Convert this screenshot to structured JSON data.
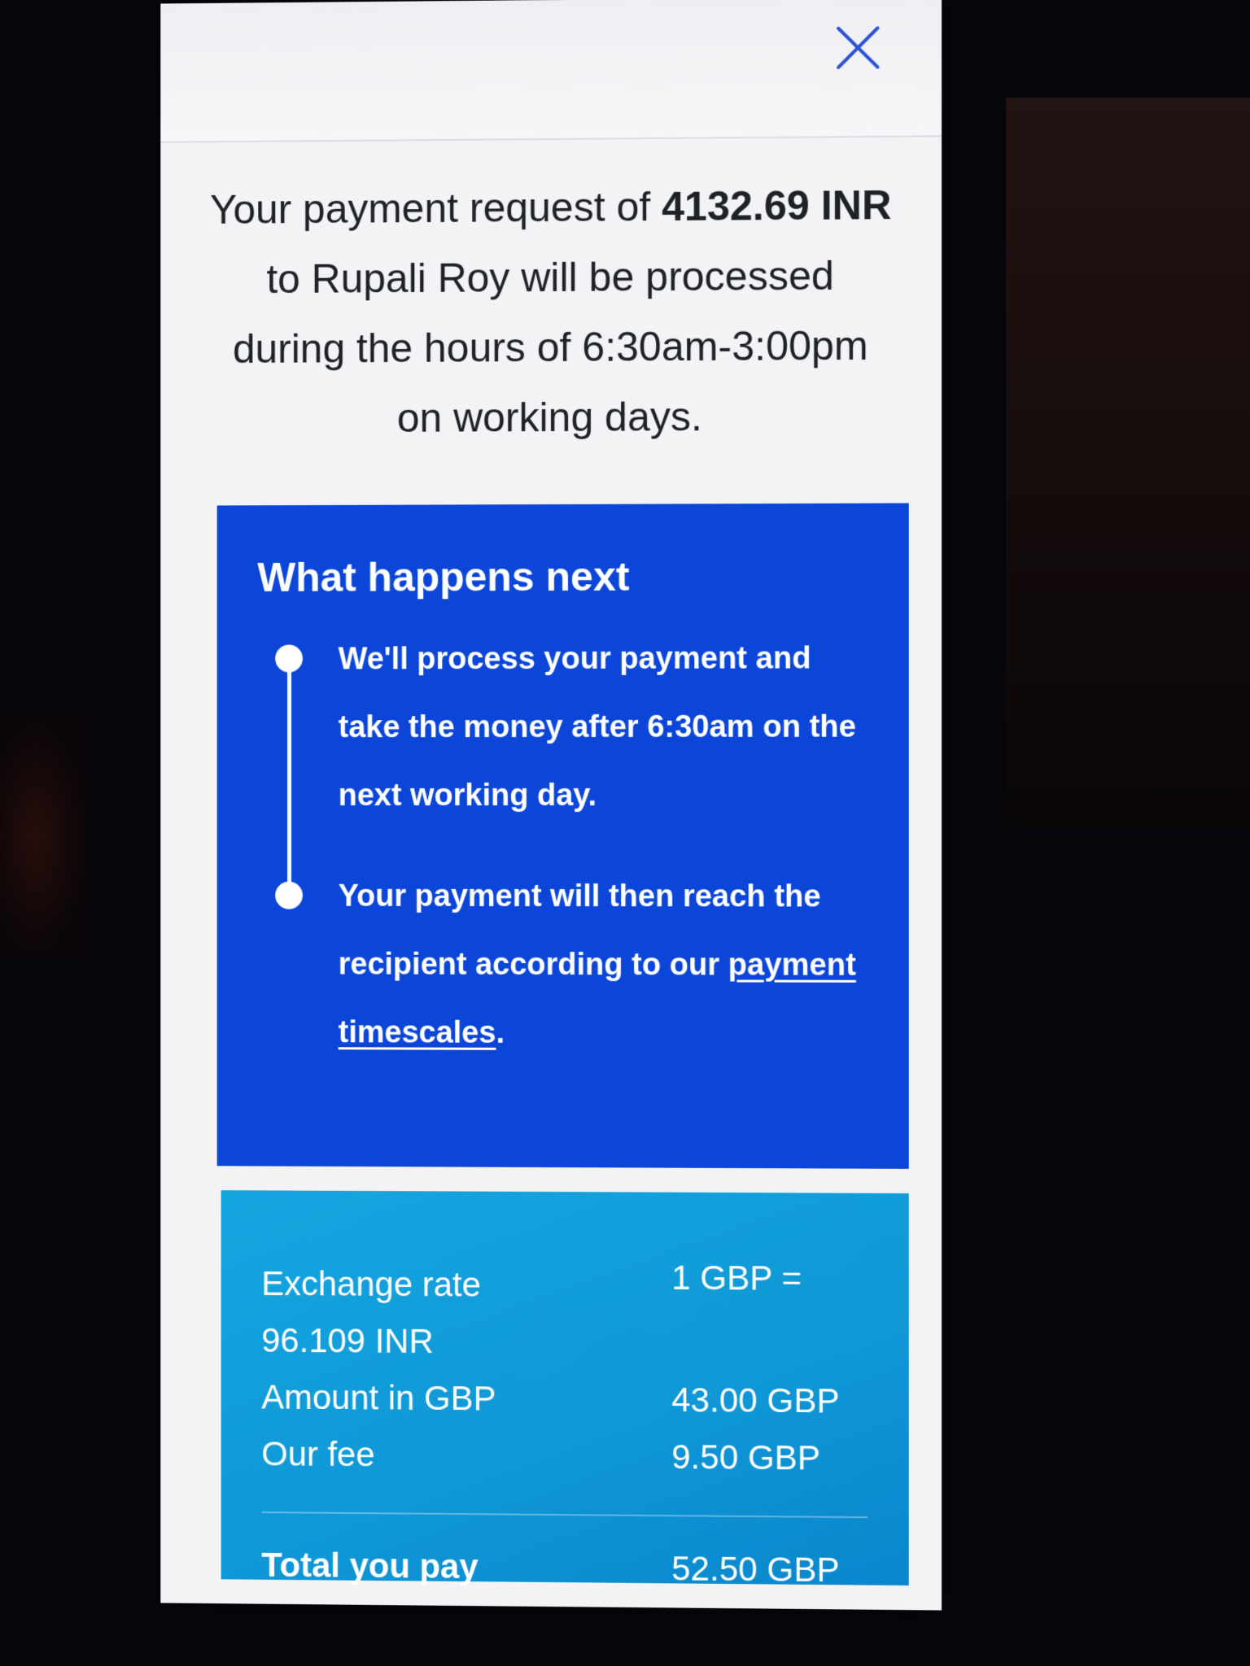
{
  "message": {
    "prefix": "Your payment request of ",
    "amount": "4132.69",
    "currency": "INR",
    "suffix": " to Rupali Roy will be processed during the hours of 6:30am-3:00pm on working days."
  },
  "next": {
    "title": "What happens next",
    "steps": [
      {
        "text": "We'll process your payment and take the money after 6:30am on the next working day."
      },
      {
        "text": "Your payment will then reach the recipient according to our ",
        "link": "payment timescales",
        "after": "."
      }
    ]
  },
  "summary": {
    "exchange_label": "Exchange rate",
    "exchange_rate_eq": "1 GBP =",
    "exchange_rate_value": "96.109 INR",
    "amount_label": "Amount in GBP",
    "amount_value": "43.00 GBP",
    "fee_label": "Our fee",
    "fee_value": "9.50 GBP",
    "total_label": "Total you pay",
    "total_value": "52.50 GBP"
  },
  "icons": {
    "close": "close-icon"
  },
  "colors": {
    "next_card": "#0b46d9",
    "summary_card": "#0f97d6",
    "close_icon": "#2b52d6"
  }
}
